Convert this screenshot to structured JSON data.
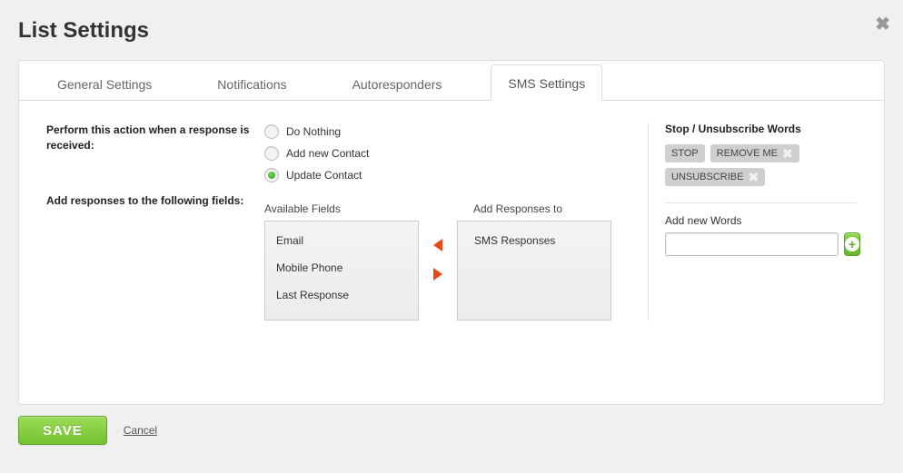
{
  "header": {
    "title": "List Settings"
  },
  "tabs": [
    {
      "label": "General Settings",
      "active": false
    },
    {
      "label": "Notifications",
      "active": false
    },
    {
      "label": "Autoresponders",
      "active": false
    },
    {
      "label": "SMS Settings",
      "active": true
    }
  ],
  "sms": {
    "action_label": "Perform this action when a response is received:",
    "options": [
      {
        "label": "Do Nothing",
        "selected": false
      },
      {
        "label": "Add new Contact",
        "selected": false
      },
      {
        "label": "Update Contact",
        "selected": true
      }
    ],
    "fields_label": "Add responses to the following fields:",
    "available": {
      "title": "Available Fields",
      "items": [
        "Email",
        "Mobile Phone",
        "Last Response"
      ]
    },
    "responses": {
      "title": "Add Responses to",
      "items": [
        "SMS Responses"
      ]
    }
  },
  "unsubscribe": {
    "title": "Stop / Unsubscribe Words",
    "tags": [
      {
        "text": "STOP",
        "removable": false
      },
      {
        "text": "REMOVE ME",
        "removable": true
      },
      {
        "text": "UNSUBSCRIBE",
        "removable": true
      }
    ],
    "add_label": "Add new Words",
    "input_value": ""
  },
  "footer": {
    "save_label": "SAVE",
    "cancel_label": "Cancel"
  }
}
